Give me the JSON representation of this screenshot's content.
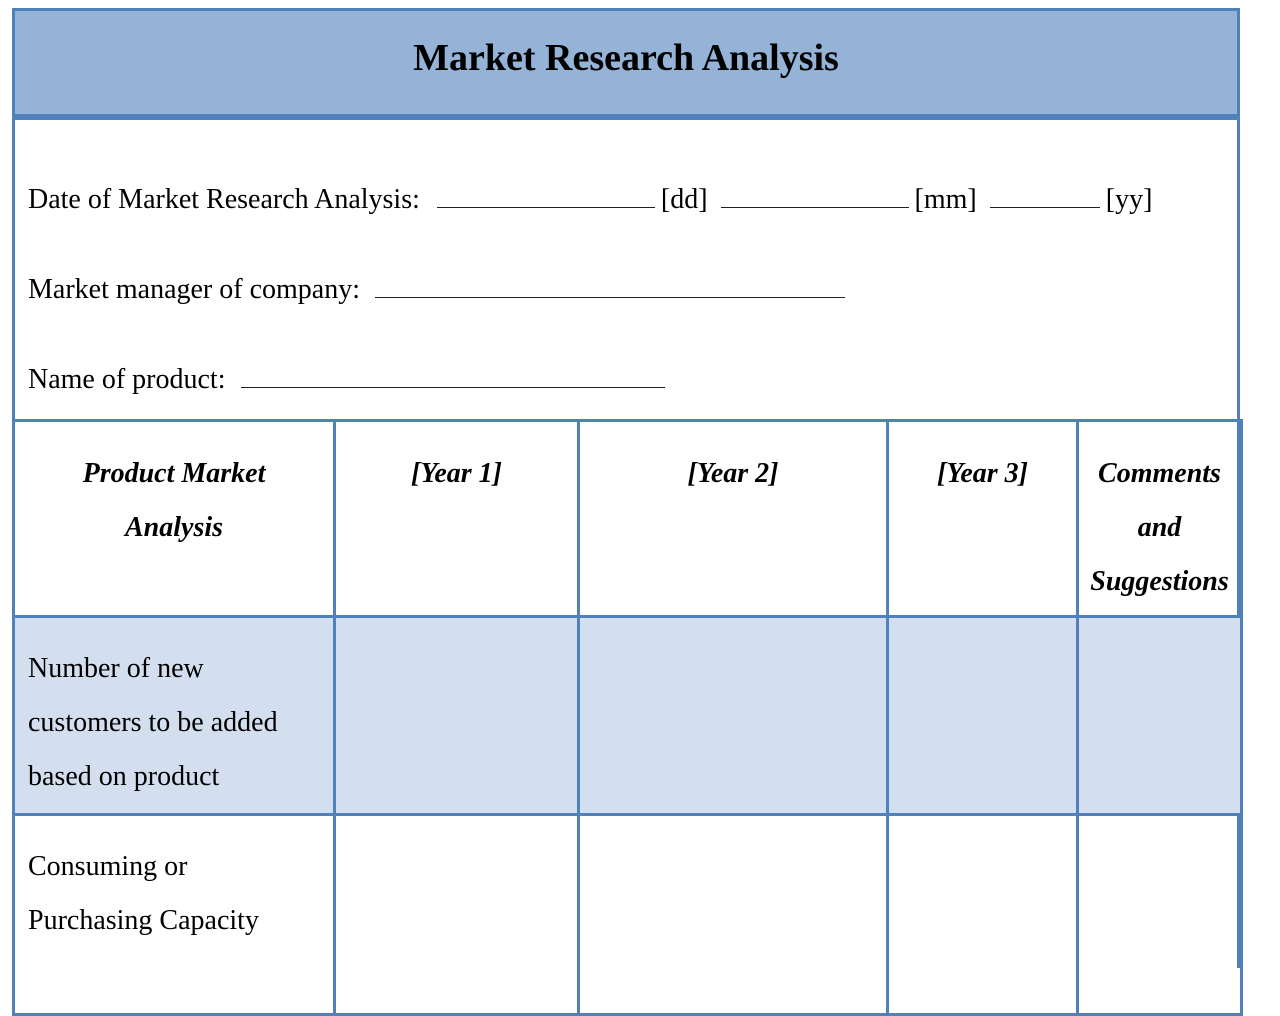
{
  "document": {
    "title": "Market Research Analysis",
    "fields": {
      "date_label": "Date of Market Research Analysis:",
      "date_dd": "[dd]",
      "date_mm": "[mm]",
      "date_yy": "[yy]",
      "manager_label": "Market manager of company:",
      "product_label": "Name of product:"
    },
    "table": {
      "headers": [
        "Product Market Analysis",
        "[Year 1]",
        "[Year 2]",
        "[Year 3]",
        "Comments and Suggestions"
      ],
      "rows": [
        {
          "label": "Number of new customers to be added based on product",
          "values": [
            "",
            "",
            "",
            ""
          ]
        },
        {
          "label": "Consuming or Purchasing Capacity",
          "values": [
            "",
            "",
            "",
            ""
          ]
        }
      ]
    },
    "colors": {
      "header_fill": "#95b3d7",
      "border": "#4f81bd",
      "band_fill": "#d3dfee"
    }
  }
}
